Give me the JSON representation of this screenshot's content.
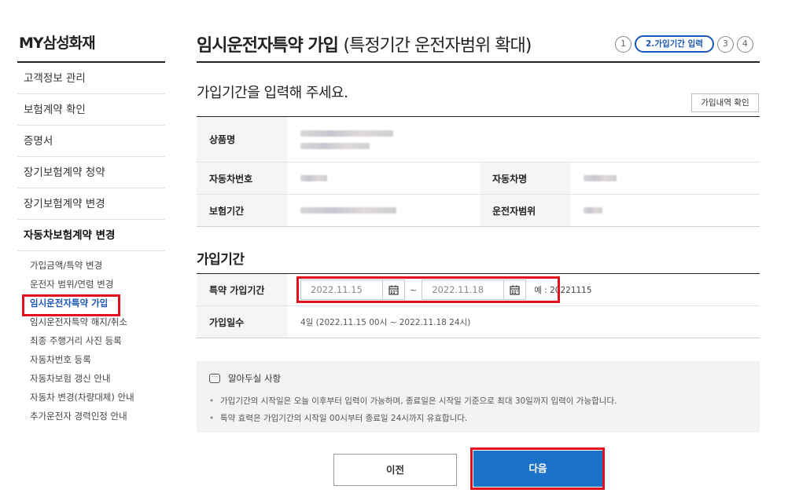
{
  "sidebar": {
    "title": "MY삼성화재",
    "items": [
      {
        "label": "고객정보 관리"
      },
      {
        "label": "보험계약 확인"
      },
      {
        "label": "증명서"
      },
      {
        "label": "장기보험계약 청약"
      },
      {
        "label": "장기보험계약 변경"
      },
      {
        "label": "자동차보험계약 변경"
      }
    ],
    "subitems": [
      {
        "label": "가입금액/특약 변경"
      },
      {
        "label": "운전자 범위/연령 변경"
      },
      {
        "label": "임시운전자특약 가입"
      },
      {
        "label": "임시운전자특약 해지/취소"
      },
      {
        "label": "최종 주행거리 사진 등록"
      },
      {
        "label": "자동차번호 등록"
      },
      {
        "label": "자동차보험 갱신 안내"
      },
      {
        "label": "자동차 변경(차량대체) 안내"
      },
      {
        "label": "추가운전자 경력인정 안내"
      }
    ]
  },
  "header": {
    "title": "임시운전자특약 가입",
    "subtitle": "(특정기간 운전자범위 확대)",
    "steps": [
      "1",
      "2.가입기간 입력",
      "3",
      "4"
    ]
  },
  "lead": "가입기간을 입력해 주세요.",
  "history_button": "가입내역 확인",
  "info": {
    "product_label": "상품명",
    "car_number_label": "자동차번호",
    "car_name_label": "자동차명",
    "period_label": "보험기간",
    "driver_range_label": "운전자범위"
  },
  "period": {
    "section_title": "가입기간",
    "rider_period_label": "특약 가입기간",
    "start_placeholder": "2022.11.15",
    "end_placeholder": "2022.11.18",
    "tilde": "~",
    "example": "예 : 20221115",
    "days_label": "가입일수",
    "days_value": "4일 (2022.11.15 00시 ~ 2022.11.18 24시)"
  },
  "notice": {
    "title": "알아두실 사항",
    "icon": "speech-bubble-icon",
    "items": [
      "가입기간의 시작일은 오늘 이후부터 입력이 가능하며, 종료일은 시작일 기준으로 최대 30일까지 입력이 가능합니다.",
      "특약 효력은 가입기간의 시작일 00시부터 종료일 24시까지 유효합니다."
    ]
  },
  "buttons": {
    "prev": "이전",
    "next": "다음"
  },
  "colors": {
    "accent": "#1a73c8",
    "highlight": "#e0101f",
    "active_link": "#1a57b8"
  }
}
